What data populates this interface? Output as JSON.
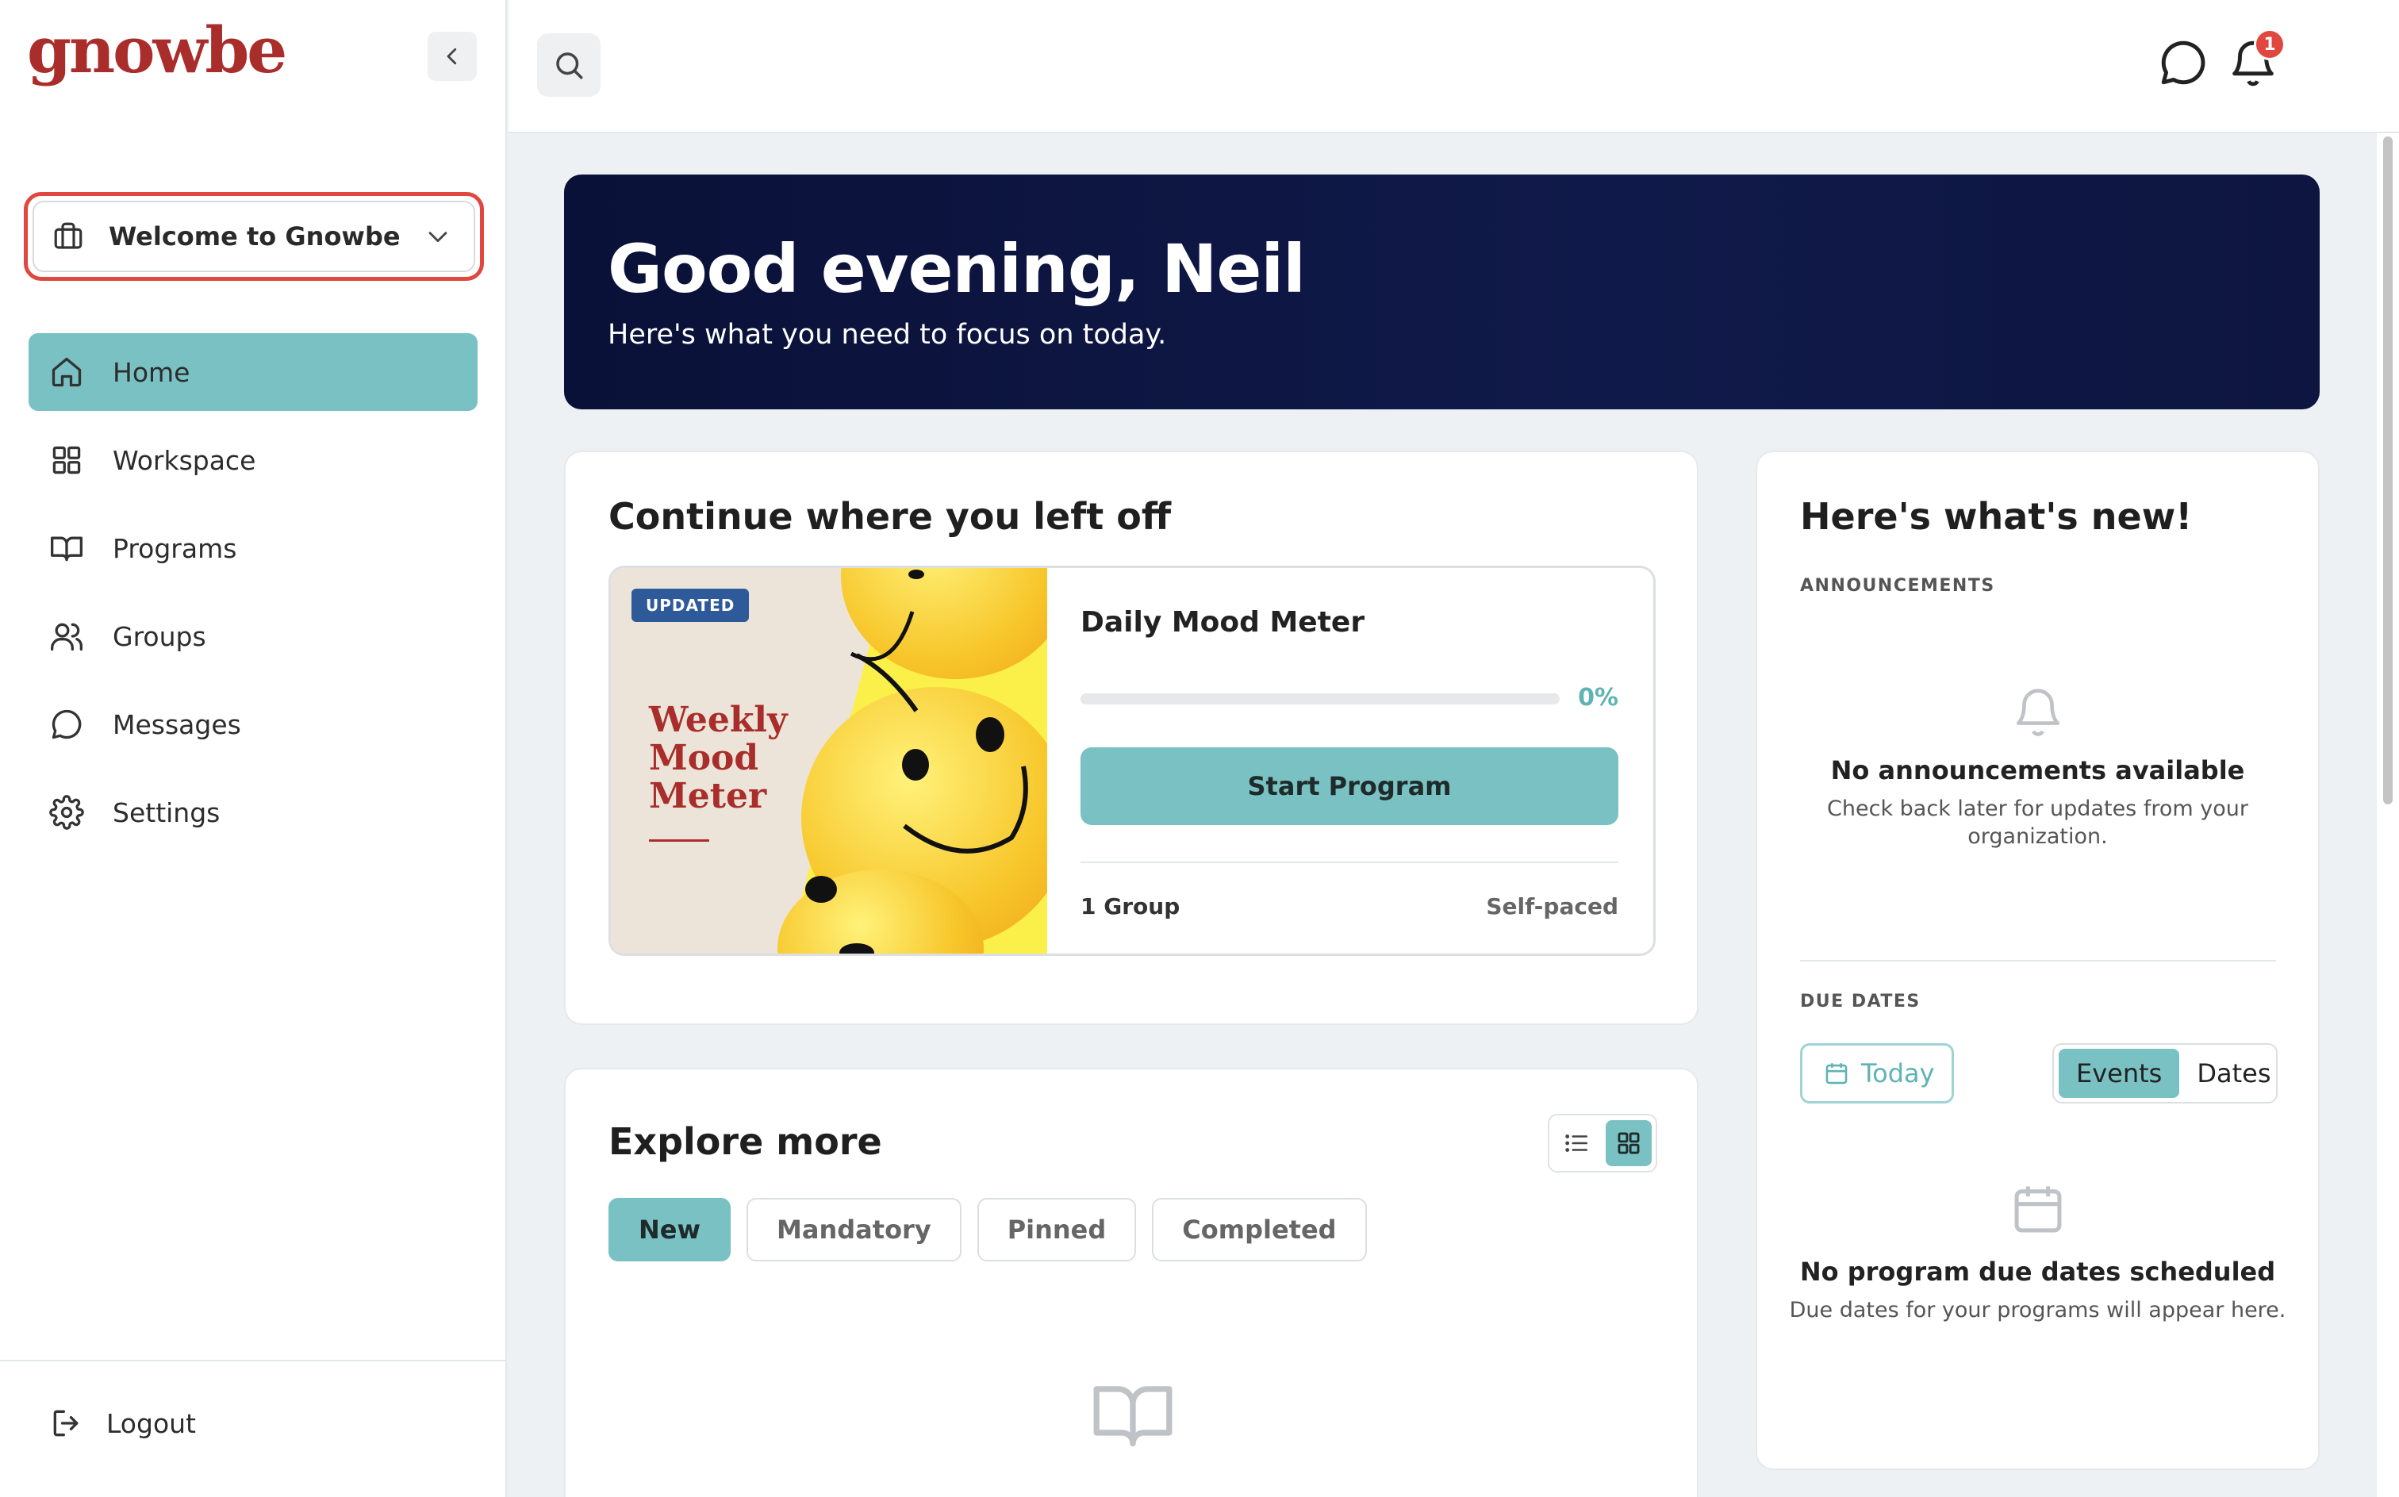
{
  "brand": {
    "logo_text": "gnowbe",
    "color": "#a92e2b"
  },
  "theme": {
    "accent": "#79c1c2",
    "hero_bg": "#0a1138",
    "alert": "#e0473e"
  },
  "sidebar": {
    "workspace_selector": {
      "label": "Welcome to Gnowbe"
    },
    "items": [
      {
        "label": "Home",
        "icon": "home-icon",
        "active": true
      },
      {
        "label": "Workspace",
        "icon": "grid-icon",
        "active": false
      },
      {
        "label": "Programs",
        "icon": "book-icon",
        "active": false
      },
      {
        "label": "Groups",
        "icon": "users-icon",
        "active": false
      },
      {
        "label": "Messages",
        "icon": "chat-icon",
        "active": false
      },
      {
        "label": "Settings",
        "icon": "gear-icon",
        "active": false
      }
    ],
    "logout_label": "Logout"
  },
  "topbar": {
    "notification_count": "1"
  },
  "hero": {
    "greeting": "Good evening, Neil",
    "subtitle": "Here's what you need to focus on today."
  },
  "continue": {
    "title": "Continue where you left off",
    "program": {
      "badge": "UPDATED",
      "thumbnail_title": "Weekly Mood Meter",
      "name": "Daily Mood Meter",
      "progress": 0,
      "progress_label": "0%",
      "button_label": "Start Program",
      "groups": "1 Group",
      "pace": "Self-paced"
    }
  },
  "explore": {
    "title": "Explore more",
    "tabs": [
      {
        "label": "New",
        "active": true
      },
      {
        "label": "Mandatory",
        "active": false
      },
      {
        "label": "Pinned",
        "active": false
      },
      {
        "label": "Completed",
        "active": false
      }
    ],
    "view_mode": "grid"
  },
  "whats_new": {
    "title": "Here's what's new!",
    "announcements_label": "ANNOUNCEMENTS",
    "announcements_empty_title": "No announcements available",
    "announcements_empty_text": "Check back later for updates from your organization.",
    "due_dates_label": "DUE DATES",
    "today_label": "Today",
    "segment": {
      "events": "Events",
      "dates": "Dates",
      "selected": "Events"
    },
    "due_empty_title": "No program due dates scheduled",
    "due_empty_text": "Due dates for your programs will appear here."
  }
}
